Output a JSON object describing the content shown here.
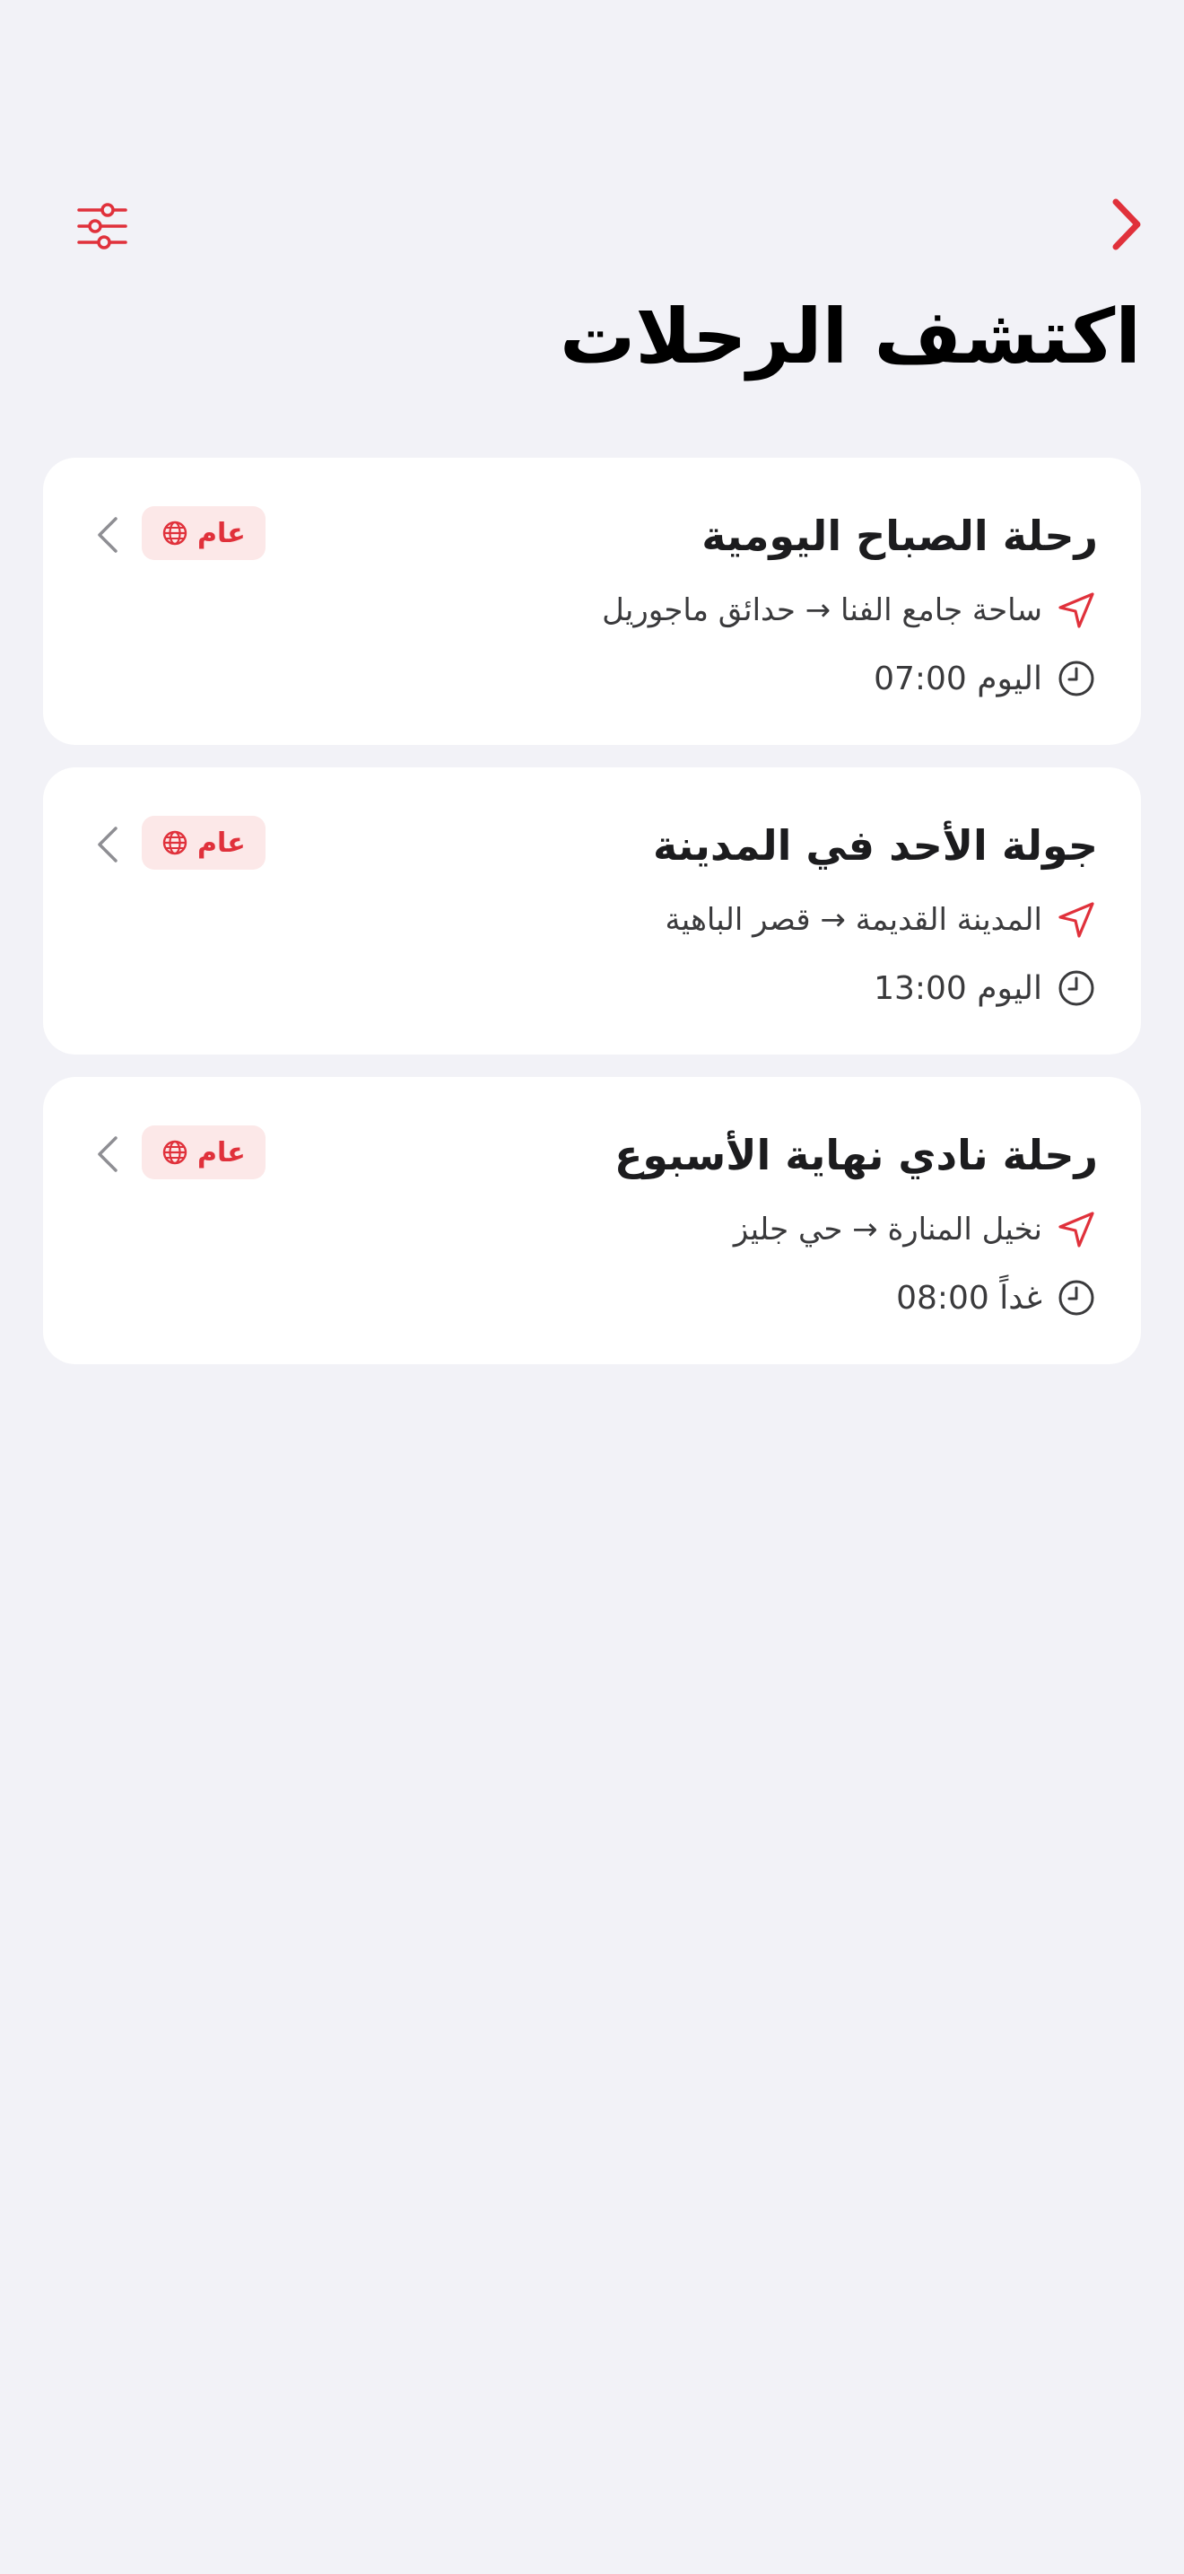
{
  "header": {
    "back_icon": "chevron-right-icon",
    "filter_icon": "sliders-icon",
    "title": "اكتشف الرحلات"
  },
  "colors": {
    "accent": "#e0313b",
    "background": "#f2f2f7",
    "card": "#ffffff",
    "badge_bg": "#fce8e8"
  },
  "trips": [
    {
      "title": "رحلة الصباح اليومية",
      "route": "ساحة جامع الفنا → حدائق ماجوريل",
      "time": "اليوم 07:00",
      "badge": "عام"
    },
    {
      "title": "جولة الأحد في المدينة",
      "route": "المدينة القديمة → قصر الباهية",
      "time": "اليوم 13:00",
      "badge": "عام"
    },
    {
      "title": "رحلة نادي نهاية الأسبوع",
      "route": "نخيل المنارة → حي جليز",
      "time": "غداً 08:00",
      "badge": "عام"
    }
  ]
}
